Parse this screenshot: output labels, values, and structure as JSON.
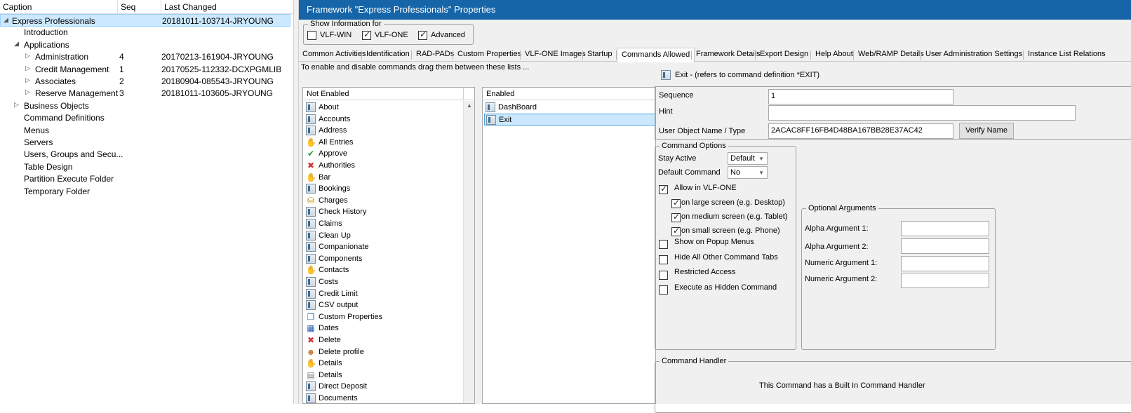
{
  "tree": {
    "columns": {
      "caption": "Caption",
      "seq": "Seq",
      "changed": "Last Changed"
    },
    "rows": [
      {
        "label": "Express Professionals",
        "seq": "",
        "changed": "20181011-103714-JRYOUNG",
        "toggle": "◢",
        "selected": true
      },
      {
        "label": "Introduction",
        "seq": "",
        "changed": ""
      },
      {
        "label": "Applications",
        "seq": "",
        "changed": "",
        "toggle": "◢"
      },
      {
        "label": "Administration",
        "seq": "4",
        "changed": "20170213-161904-JRYOUNG",
        "toggle": "▷"
      },
      {
        "label": "Credit Management",
        "seq": "1",
        "changed": "20170525-112332-DCXPGMLIB",
        "toggle": "▷"
      },
      {
        "label": "Associates",
        "seq": "2",
        "changed": "20180904-085543-JRYOUNG",
        "toggle": "▷"
      },
      {
        "label": "Reserve Management",
        "seq": "3",
        "changed": "20181011-103605-JRYOUNG",
        "toggle": "▷"
      },
      {
        "label": "Business Objects",
        "seq": "",
        "changed": "",
        "toggle": "▷"
      },
      {
        "label": "Command Definitions",
        "seq": "",
        "changed": ""
      },
      {
        "label": "Menus",
        "seq": "",
        "changed": ""
      },
      {
        "label": "Servers",
        "seq": "",
        "changed": ""
      },
      {
        "label": "Users, Groups and Secu...",
        "seq": "",
        "changed": ""
      },
      {
        "label": "Table Design",
        "seq": "",
        "changed": ""
      },
      {
        "label": "Partition Execute Folder",
        "seq": "",
        "changed": ""
      },
      {
        "label": "Temporary Folder",
        "seq": "",
        "changed": ""
      }
    ]
  },
  "window": {
    "title": "Framework \"Express Professionals\" Properties"
  },
  "show_info": {
    "legend": "Show Information for",
    "vlf_win": {
      "label": "VLF-WIN",
      "checked": false
    },
    "vlf_one": {
      "label": "VLF-ONE",
      "checked": true
    },
    "advanced": {
      "label": "Advanced",
      "checked": true
    }
  },
  "tabs": [
    "Common Activities",
    "Identification",
    "RAD-PADs",
    "Custom Properties",
    "VLF-ONE Images",
    "Startup",
    "Commands Allowed",
    "Framework Details",
    "Export Design",
    "Help About",
    "Web/RAMP Details",
    "User Administration Settings",
    "Instance List Relations"
  ],
  "active_tab": "Commands Allowed",
  "instructions": "To enable and disable commands drag them between these lists ...",
  "not_enabled": {
    "header": "Not Enabled",
    "items": [
      {
        "label": "About",
        "icon": "command-icon"
      },
      {
        "label": "Accounts",
        "icon": "command-icon"
      },
      {
        "label": "Address",
        "icon": "command-icon"
      },
      {
        "label": "All Entries",
        "icon": "hand-icon"
      },
      {
        "label": "Approve",
        "icon": "checkmark-icon"
      },
      {
        "label": "Authorities",
        "icon": "red-x-icon"
      },
      {
        "label": "Bar",
        "icon": "hand-icon"
      },
      {
        "label": "Bookings",
        "icon": "command-icon"
      },
      {
        "label": "Charges",
        "icon": "database-icon"
      },
      {
        "label": "Check History",
        "icon": "command-icon"
      },
      {
        "label": "Claims",
        "icon": "command-icon"
      },
      {
        "label": "Clean Up",
        "icon": "command-icon"
      },
      {
        "label": "Companionate",
        "icon": "command-icon"
      },
      {
        "label": "Components",
        "icon": "command-icon"
      },
      {
        "label": "Contacts",
        "icon": "hand-icon"
      },
      {
        "label": "Costs",
        "icon": "command-icon"
      },
      {
        "label": "Credit Limit",
        "icon": "command-icon"
      },
      {
        "label": "CSV output",
        "icon": "command-icon"
      },
      {
        "label": "Custom Properties",
        "icon": "properties-icon"
      },
      {
        "label": "Dates",
        "icon": "calendar-icon"
      },
      {
        "label": "Delete",
        "icon": "red-x-icon"
      },
      {
        "label": "Delete profile",
        "icon": "user-icon"
      },
      {
        "label": "Details",
        "icon": "hand-icon"
      },
      {
        "label": "Details",
        "icon": "document-icon"
      },
      {
        "label": "Direct Deposit",
        "icon": "command-icon"
      },
      {
        "label": "Documents",
        "icon": "command-icon"
      }
    ]
  },
  "enabled": {
    "header": "Enabled",
    "items": [
      {
        "label": "DashBoard",
        "icon": "command-icon",
        "selected": false
      },
      {
        "label": "Exit",
        "icon": "command-icon",
        "selected": true
      }
    ]
  },
  "command": {
    "heading": "Exit - (refers to command definition *EXIT)",
    "sequence_label": "Sequence",
    "sequence_value": "1",
    "hint_label": "Hint",
    "hint_value": "",
    "uo_label": "User Object Name / Type",
    "uo_value": "2ACAC8FF16FB4D48BA167BB28E37AC42",
    "verify_button": "Verify Name"
  },
  "options": {
    "legend": "Command Options",
    "stay_active_label": "Stay Active",
    "stay_active_value": "Default",
    "default_command_label": "Default Command",
    "default_command_value": "No",
    "allow_vlf_one": {
      "label": "Allow in VLF-ONE",
      "checked": true
    },
    "large_screen": {
      "label": "on large screen (e.g. Desktop)",
      "checked": true
    },
    "medium_screen": {
      "label": "on medium screen (e.g. Tablet)",
      "checked": true
    },
    "small_screen": {
      "label": "on small screen (e.g. Phone)",
      "checked": true
    },
    "popup_menus": {
      "label": "Show on Popup Menus",
      "checked": false
    },
    "hide_tabs": {
      "label": "Hide All Other Command Tabs",
      "checked": false
    },
    "restricted": {
      "label": "Restricted Access",
      "checked": false
    },
    "hidden_command": {
      "label": "Execute as Hidden Command",
      "checked": false
    }
  },
  "arguments": {
    "legend": "Optional Arguments",
    "alpha1_label": "Alpha Argument 1:",
    "alpha1_value": "",
    "alpha2_label": "Alpha Argument 2:",
    "alpha2_value": "",
    "numeric1_label": "Numeric Argument 1:",
    "numeric1_value": "",
    "numeric2_label": "Numeric Argument 2:",
    "numeric2_value": ""
  },
  "handler": {
    "legend": "Command Handler",
    "text": "This Command has a Built In Command Handler"
  },
  "colors": {
    "title_bar": "#1565a8",
    "selection": "#cce8ff"
  }
}
